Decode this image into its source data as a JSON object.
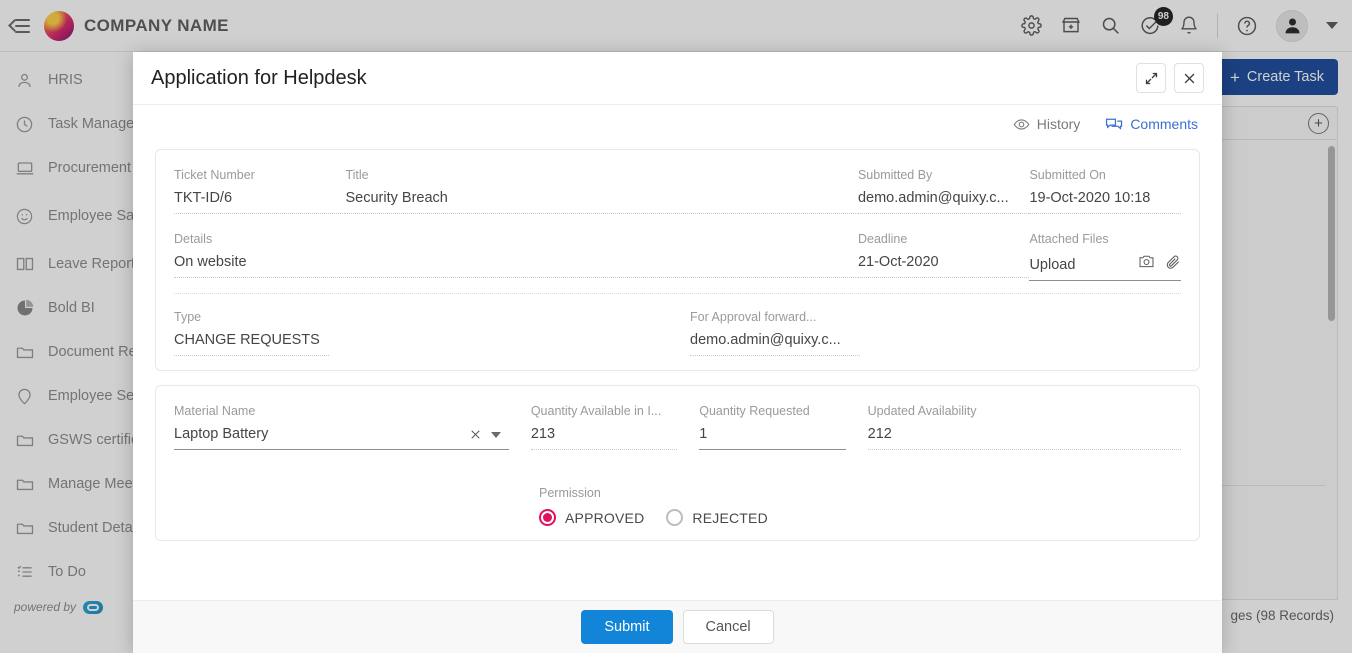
{
  "topbar": {
    "brand": "COMPANY NAME",
    "menu_icon": "hamburger-collapse-icon",
    "icons": [
      {
        "name": "settings-gear-icon",
        "label": "Settings"
      },
      {
        "name": "marketplace-store-icon",
        "label": "App Store"
      },
      {
        "name": "search-icon",
        "label": "Search"
      },
      {
        "name": "tasks-check-icon",
        "label": "Tasks",
        "badge": "98"
      },
      {
        "name": "notifications-bell-icon",
        "label": "Notifications"
      },
      {
        "name": "help-circle-icon",
        "label": "Help"
      }
    ],
    "badge_count": "98"
  },
  "sidebar": {
    "items": [
      {
        "label": "HRIS",
        "icon": "user-icon"
      },
      {
        "label": "Task Manager",
        "icon": "clock-icon"
      },
      {
        "label": "Procurement",
        "icon": "laptop-icon"
      },
      {
        "label": "Employee Sat Survey",
        "icon": "smiley-icon",
        "two_line": true
      },
      {
        "label": "Leave Report",
        "icon": "book-icon"
      },
      {
        "label": "Bold BI",
        "icon": "pie-chart-icon"
      },
      {
        "label": "Document Re",
        "icon": "folder-icon"
      },
      {
        "label": "Employee Sel",
        "icon": "location-pin-icon"
      },
      {
        "label": "GSWS certific",
        "icon": "folder-icon"
      },
      {
        "label": "Manage Meeti",
        "icon": "folder-icon"
      },
      {
        "label": "Student Detai",
        "icon": "folder-icon"
      },
      {
        "label": "To Do",
        "icon": "checklist-icon"
      }
    ],
    "powered_by": "powered by"
  },
  "background": {
    "create_task_label": "Create Task",
    "create_task_plus": "+",
    "add_icon": "plus-circle-icon",
    "records_label": "ges (98 Records)"
  },
  "modal": {
    "title": "Application for Helpdesk",
    "expand_icon": "expand-diagonal-icon",
    "close_icon": "close-x-icon",
    "history_label": "History",
    "history_icon": "eye-icon",
    "comments_label": "Comments",
    "comments_icon": "comments-bubble-icon",
    "section_ticket": {
      "ticket_number": {
        "label": "Ticket Number",
        "value": "TKT-ID/6"
      },
      "title": {
        "label": "Title",
        "value": "Security Breach"
      },
      "submitted_by": {
        "label": "Submitted By",
        "value": "demo.admin@quixy.c..."
      },
      "submitted_on": {
        "label": "Submitted On",
        "value": "19-Oct-2020 10:18"
      },
      "details": {
        "label": "Details",
        "value": "On website"
      },
      "deadline": {
        "label": "Deadline",
        "value": "21-Oct-2020"
      },
      "attached_files": {
        "label": "Attached Files",
        "value": "Upload",
        "camera_icon": "camera-icon",
        "attach_icon": "paperclip-icon"
      },
      "type": {
        "label": "Type",
        "value": "CHANGE REQUESTS"
      },
      "approval_forward": {
        "label": "For Approval forward...",
        "value": "demo.admin@quixy.c..."
      }
    },
    "section_material": {
      "material_name": {
        "label": "Material Name",
        "value": "Laptop Battery",
        "clear_icon": "clear-x-icon",
        "dropdown_icon": "chevron-down-icon"
      },
      "quantity_available": {
        "label": "Quantity Available in I...",
        "value": "213"
      },
      "quantity_requested": {
        "label": "Quantity Requested",
        "value": "1"
      },
      "updated_availability": {
        "label": "Updated Availability",
        "value": "212"
      },
      "permission": {
        "label": "Permission",
        "selected": "APPROVED",
        "options": [
          {
            "label": "APPROVED",
            "checked": true
          },
          {
            "label": "REJECTED",
            "checked": false
          }
        ]
      }
    },
    "footer": {
      "submit_label": "Submit",
      "cancel_label": "Cancel"
    }
  },
  "colors": {
    "accent_blue": "#1285d8",
    "nav_blue": "#1e4d9e",
    "radio_pink": "#e0115f",
    "link_blue": "#3b6fd4"
  }
}
